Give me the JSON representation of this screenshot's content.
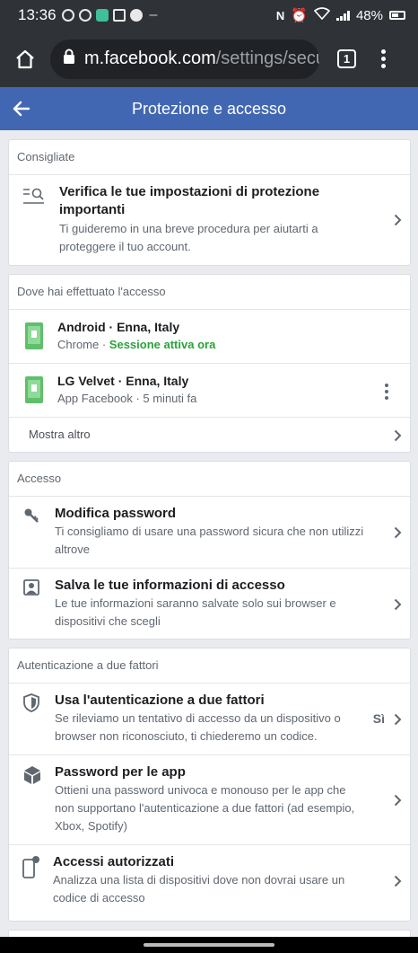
{
  "status_bar": {
    "time": "13:36",
    "battery": "48%",
    "extra": "–",
    "nfc": "N"
  },
  "browser": {
    "url_host": "m.facebook.com",
    "url_path": "/settings/secu",
    "tab_count": "1"
  },
  "header": {
    "title": "Protezione e accesso"
  },
  "recommended": {
    "header": "Consigliate",
    "item": {
      "title": "Verifica le tue impostazioni di protezione importanti",
      "desc": "Ti guideremo in una breve procedura per aiutarti a proteggere il tuo account."
    }
  },
  "logins": {
    "header": "Dove hai effettuato l'accesso",
    "items": [
      {
        "device": "Android · Enna, Italy",
        "app": "Chrome · ",
        "status": "Sessione attiva ora"
      },
      {
        "device": "LG Velvet · Enna, Italy",
        "app": "App Facebook · 5 minuti fa",
        "status": ""
      }
    ],
    "show_more": "Mostra altro"
  },
  "access": {
    "header": "Accesso",
    "items": [
      {
        "title": "Modifica password",
        "desc": "Ti consigliamo di usare una password sicura che non utilizzi altrove"
      },
      {
        "title": "Salva le tue informazioni di accesso",
        "desc": "Le tue informazioni saranno salvate solo sui browser e dispositivi che scegli"
      }
    ]
  },
  "two_factor": {
    "header": "Autenticazione a due fattori",
    "items": [
      {
        "title": "Usa l'autenticazione a due fattori",
        "desc": "Se rileviamo un tentativo di accesso da un dispositivo o browser non riconosciuto, ti chiederemo un codice.",
        "value": "Sì"
      },
      {
        "title": "Password per le app",
        "desc": "Ottieni una password univoca e monouso per le app che non supportano l'autenticazione a due fattori (ad esempio, Xbox, Spotify)"
      },
      {
        "title": "Accessi autorizzati",
        "desc": "Analizza una lista di dispositivi dove non dovrai usare un codice di accesso"
      }
    ]
  }
}
